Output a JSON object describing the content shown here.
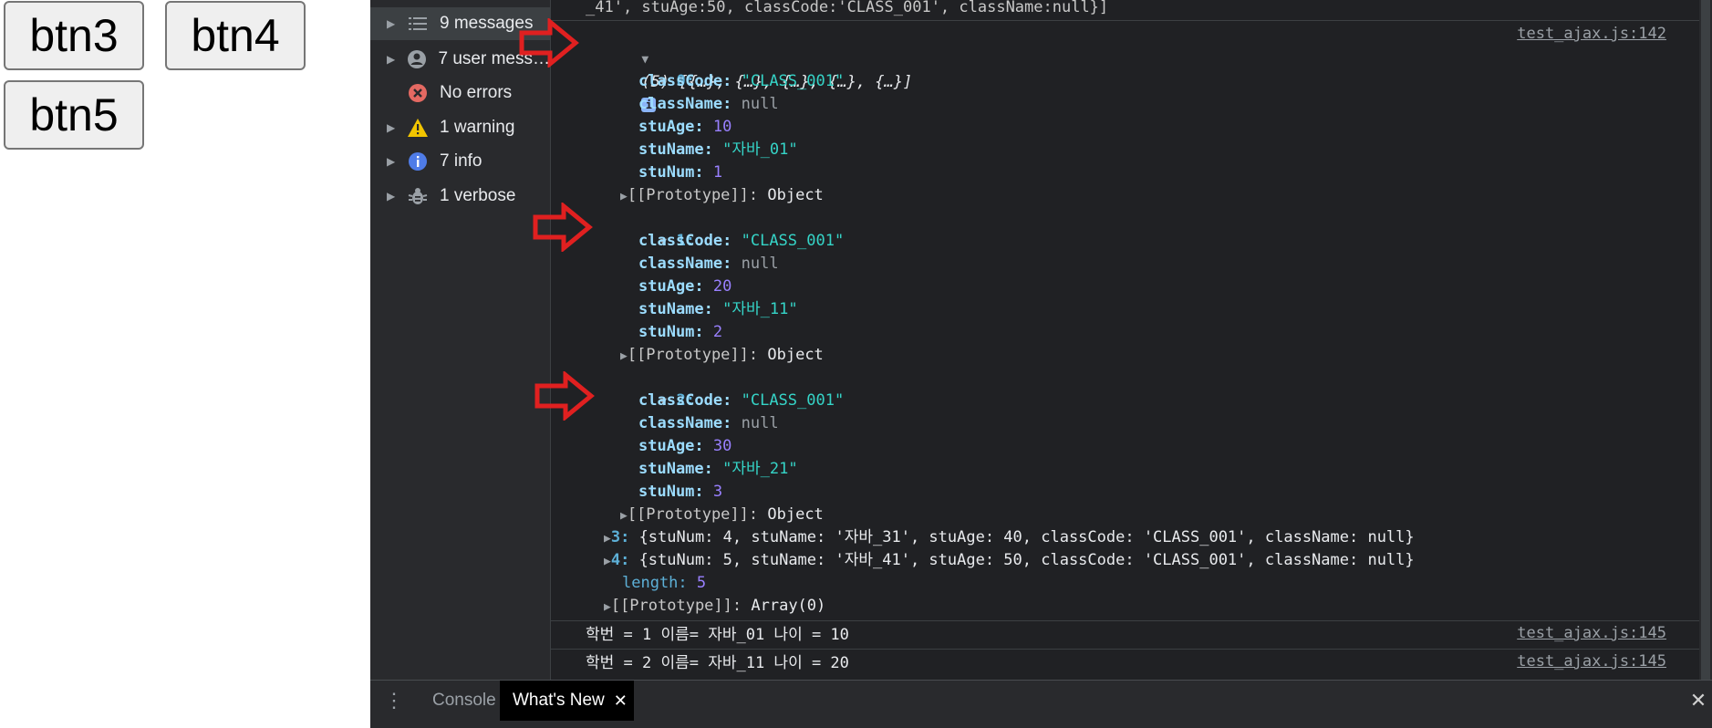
{
  "page": {
    "buttons": [
      "btn3",
      "btn4",
      "btn5"
    ]
  },
  "sidebar": {
    "items": [
      {
        "label": "9 messages",
        "icon": "list-icon"
      },
      {
        "label": "7 user mess…",
        "icon": "user-icon"
      },
      {
        "label": "No errors",
        "icon": "error-icon"
      },
      {
        "label": "1 warning",
        "icon": "warning-icon"
      },
      {
        "label": "7 info",
        "icon": "info-icon"
      },
      {
        "label": "1 verbose",
        "icon": "bug-icon"
      }
    ]
  },
  "console": {
    "truncated_line": "_41', stuAge:50, classCode:'CLASS_001', className:null}]",
    "array_summary": "(5) [{…}, {…}, {…}, {…}, {…}]",
    "source_link": "test_ajax.js:142",
    "objects": [
      {
        "index": "0:",
        "classCode": "\"CLASS_001\"",
        "className": "null",
        "stuAge": "10",
        "stuName": "\"자바_01\"",
        "stuNum": "1"
      },
      {
        "index": "1:",
        "classCode": "\"CLASS_001\"",
        "className": "null",
        "stuAge": "20",
        "stuName": "\"자바_11\"",
        "stuNum": "2"
      },
      {
        "index": "2:",
        "classCode": "\"CLASS_001\"",
        "className": "null",
        "stuAge": "30",
        "stuName": "\"자바_21\"",
        "stuNum": "3"
      }
    ],
    "keys": {
      "classCode": "classCode:",
      "className": "className:",
      "stuAge": "stuAge:",
      "stuName": "stuName:",
      "stuNum": "stuNum:",
      "prototype": "[[Prototype]]:",
      "prototype_value": "Object"
    },
    "collapsed": [
      {
        "index": "3:",
        "text": "{stuNum: 4, stuName: '자바_31', stuAge: 40, classCode: 'CLASS_001', className: null}"
      },
      {
        "index": "4:",
        "text": "{stuNum: 5, stuName: '자바_41', stuAge: 50, classCode: 'CLASS_001', className: null}"
      }
    ],
    "length_key": "length:",
    "length_value": "5",
    "array_prototype_key": "[[Prototype]]:",
    "array_prototype_value": "Array(0)",
    "log_lines": [
      {
        "text": "학번 = 1 이름= 자바_01 나이 = 10",
        "link": "test_ajax.js:145"
      },
      {
        "text": "학번 = 2 이름= 자바_11 나이 = 20",
        "link": "test_ajax.js:145"
      }
    ]
  },
  "bottom_tabs": {
    "console": "Console",
    "whats_new": "What's New"
  },
  "colors": {
    "devtools_bg": "#202124",
    "sidebar_bg": "#292a2d",
    "arrow_red": "#e02020",
    "string": "#35d4c7",
    "number": "#9980ff"
  }
}
